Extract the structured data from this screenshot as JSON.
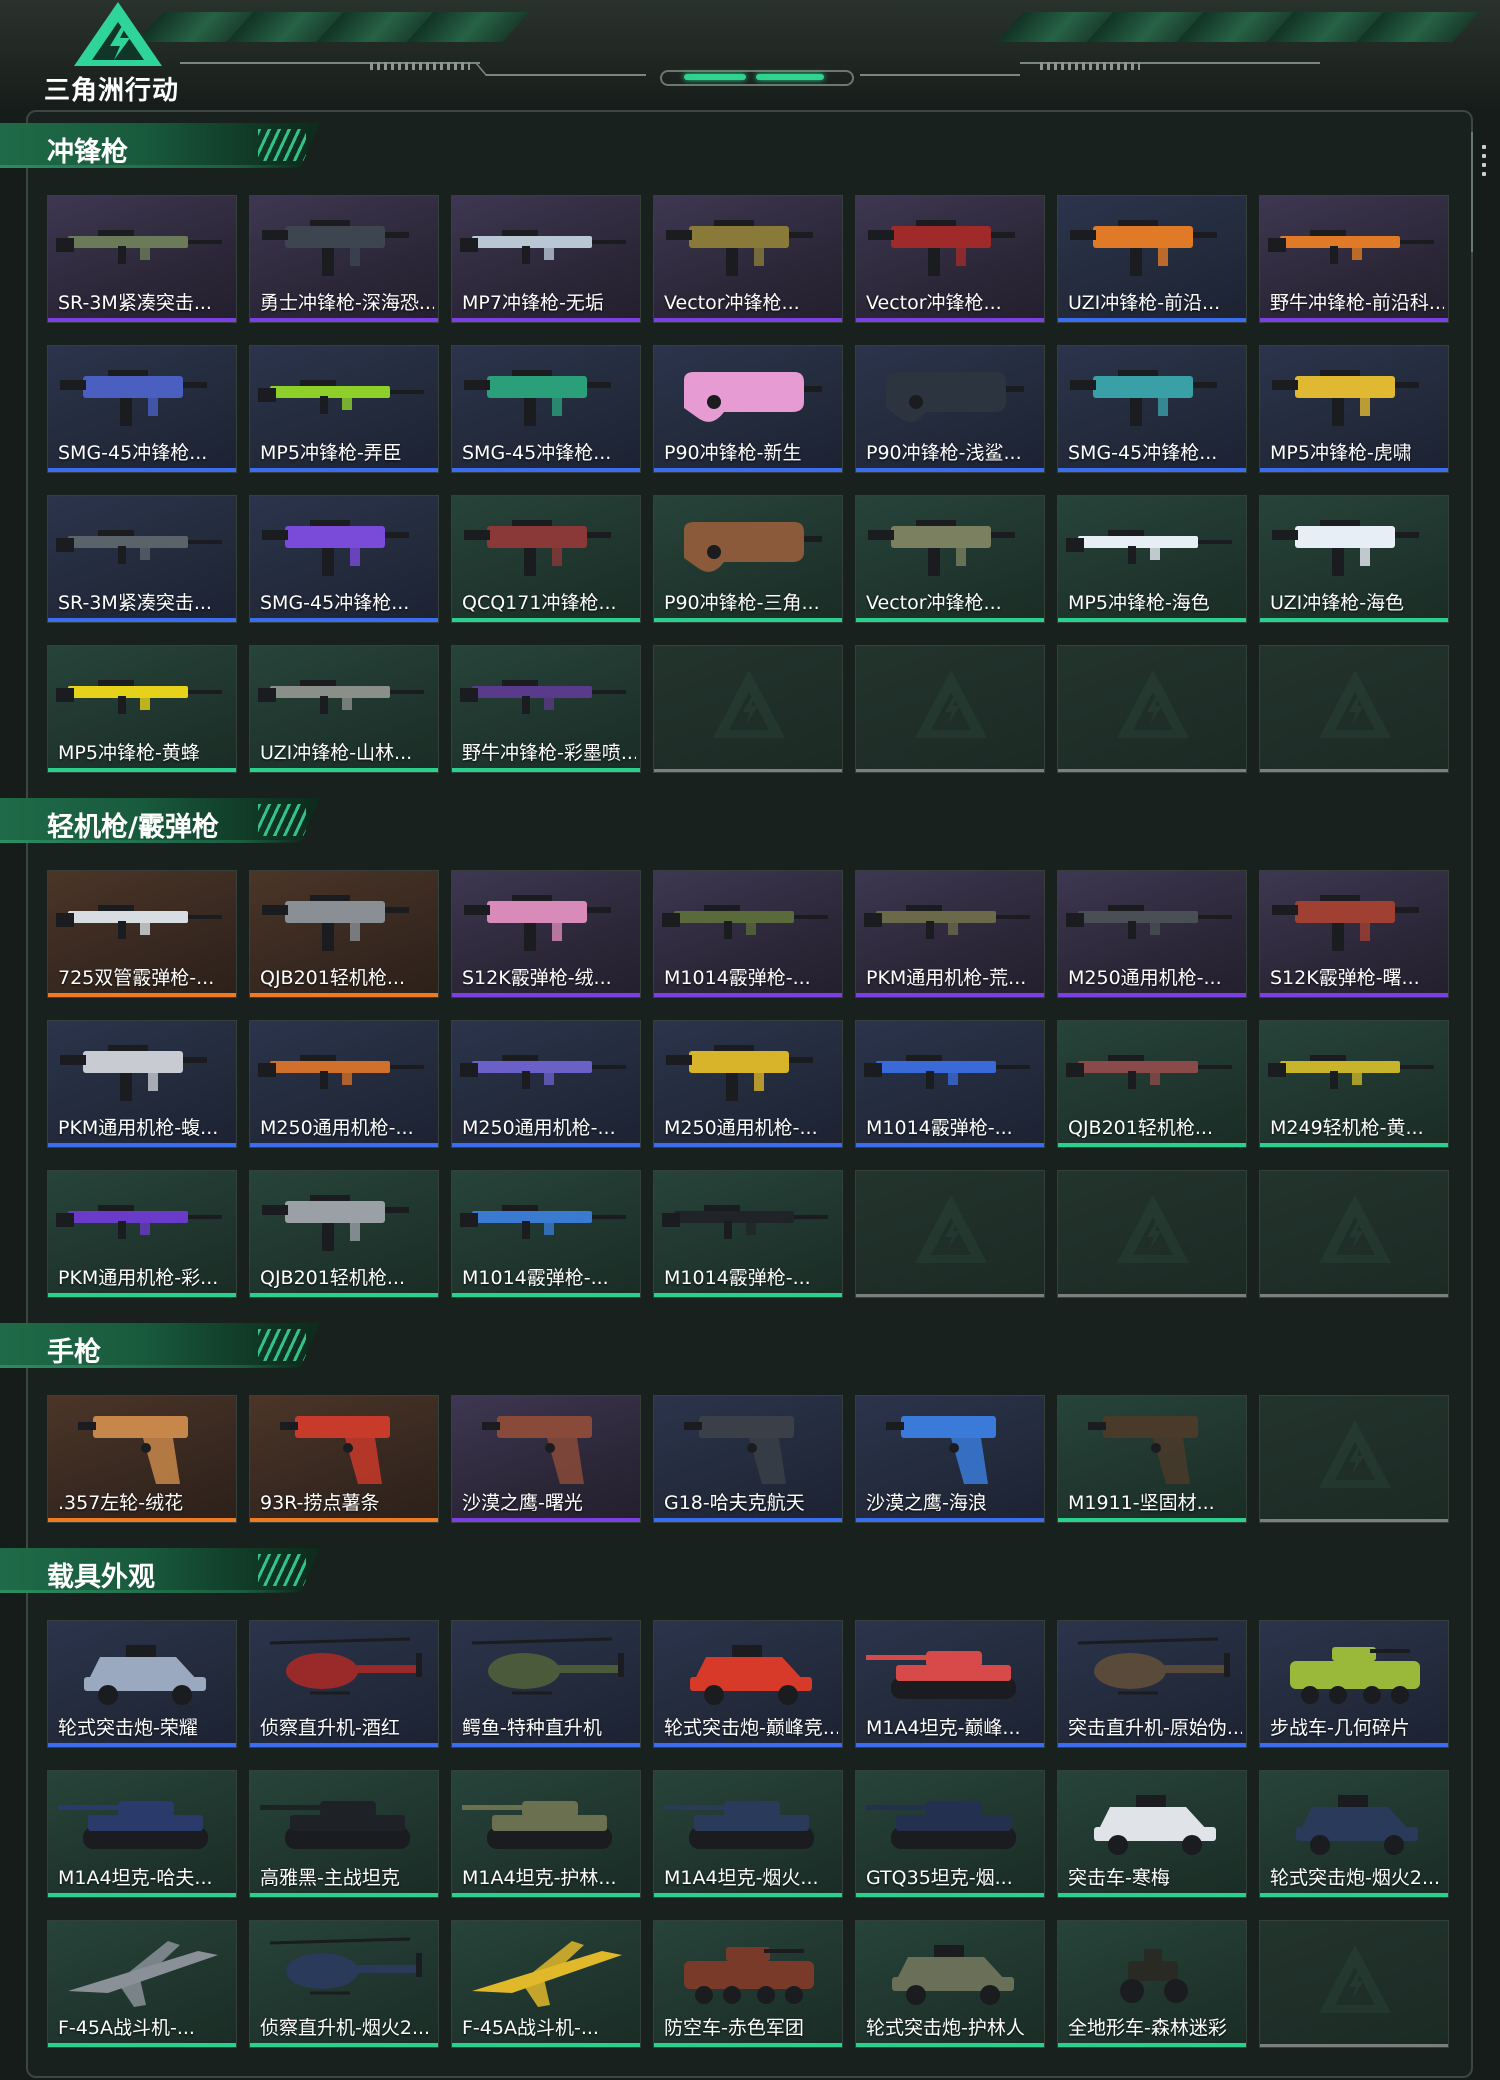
{
  "header": {
    "logo_text": "三角洲行动"
  },
  "colors": {
    "purple": "#7b3fe4",
    "blue": "#3a6df0",
    "green": "#2ad08e",
    "orange": "#f07a21",
    "accent": "#2ed48f"
  },
  "sections": [
    {
      "title": "冲锋枪",
      "items": [
        {
          "label": "SR-3M紧凑突击...",
          "rarity": "purple",
          "kind": "gun",
          "tint": "#6b7a58"
        },
        {
          "label": "勇士冲锋枪-深海恐...",
          "rarity": "purple",
          "kind": "smg",
          "tint": "#3c4550"
        },
        {
          "label": "MP7冲锋枪-无垢",
          "rarity": "purple",
          "kind": "gun",
          "tint": "#b9c6d4"
        },
        {
          "label": "Vector冲锋枪...",
          "rarity": "purple",
          "kind": "smg",
          "tint": "#8a7a3a"
        },
        {
          "label": "Vector冲锋枪...",
          "rarity": "purple",
          "kind": "smg",
          "tint": "#a02a2a"
        },
        {
          "label": "UZI冲锋枪-前沿...",
          "rarity": "blue",
          "kind": "smg",
          "tint": "#e07a26"
        },
        {
          "label": "野牛冲锋枪-前沿科...",
          "rarity": "purple",
          "kind": "gun",
          "tint": "#e07a26"
        },
        {
          "label": "SMG-45冲锋枪...",
          "rarity": "blue",
          "kind": "smg",
          "tint": "#4a5fc0"
        },
        {
          "label": "MP5冲锋枪-弄臣",
          "rarity": "blue",
          "kind": "gun",
          "tint": "#8fcf2a"
        },
        {
          "label": "SMG-45冲锋枪...",
          "rarity": "blue",
          "kind": "smg",
          "tint": "#2a9f7a"
        },
        {
          "label": "P90冲锋枪-新生",
          "rarity": "blue",
          "kind": "p90",
          "tint": "#e79bd3"
        },
        {
          "label": "P90冲锋枪-浅鲨...",
          "rarity": "blue",
          "kind": "p90",
          "tint": "#2c3440"
        },
        {
          "label": "SMG-45冲锋枪...",
          "rarity": "blue",
          "kind": "smg",
          "tint": "#3aa0a8"
        },
        {
          "label": "MP5冲锋枪-虎啸",
          "rarity": "blue",
          "kind": "smg",
          "tint": "#e0b832"
        },
        {
          "label": "SR-3M紧凑突击...",
          "rarity": "blue",
          "kind": "gun",
          "tint": "#5a626a"
        },
        {
          "label": "SMG-45冲锋枪...",
          "rarity": "blue",
          "kind": "smg",
          "tint": "#7a4ad8"
        },
        {
          "label": "QCQ171冲锋枪...",
          "rarity": "green",
          "kind": "smg",
          "tint": "#8a3838"
        },
        {
          "label": "P90冲锋枪-三角...",
          "rarity": "green",
          "kind": "p90",
          "tint": "#8a5a3a"
        },
        {
          "label": "Vector冲锋枪...",
          "rarity": "green",
          "kind": "smg",
          "tint": "#7a8060"
        },
        {
          "label": "MP5冲锋枪-海色",
          "rarity": "green",
          "kind": "gun",
          "tint": "#e8eef6"
        },
        {
          "label": "UZI冲锋枪-海色",
          "rarity": "green",
          "kind": "smg",
          "tint": "#e8eef6"
        },
        {
          "label": "MP5冲锋枪-黄蜂",
          "rarity": "green",
          "kind": "gun",
          "tint": "#e6d21a"
        },
        {
          "label": "UZI冲锋枪-山林...",
          "rarity": "green",
          "kind": "gun",
          "tint": "#8a8f8a"
        },
        {
          "label": "野牛冲锋枪-彩墨喷...",
          "rarity": "green",
          "kind": "gun",
          "tint": "#5a3a8a"
        },
        {
          "empty": true
        },
        {
          "empty": true
        },
        {
          "empty": true
        },
        {
          "empty": true
        }
      ]
    },
    {
      "title": "轻机枪/霰弹枪",
      "items": [
        {
          "label": "725双管霰弹枪-...",
          "rarity": "orange",
          "kind": "gun",
          "tint": "#d8dde2"
        },
        {
          "label": "QJB201轻机枪...",
          "rarity": "orange",
          "kind": "smg",
          "tint": "#8a8f95"
        },
        {
          "label": "S12K霰弹枪-绒...",
          "rarity": "purple",
          "kind": "smg",
          "tint": "#d88ab8"
        },
        {
          "label": "M1014霰弹枪-...",
          "rarity": "purple",
          "kind": "gun",
          "tint": "#5a6a3a"
        },
        {
          "label": "PKM通用机枪-荒...",
          "rarity": "purple",
          "kind": "gun",
          "tint": "#6a6a4a"
        },
        {
          "label": "M250通用机枪-...",
          "rarity": "purple",
          "kind": "gun",
          "tint": "#4a4f55"
        },
        {
          "label": "S12K霰弹枪-曙...",
          "rarity": "purple",
          "kind": "smg",
          "tint": "#a04032"
        },
        {
          "label": "PKM通用机枪-蝮...",
          "rarity": "blue",
          "kind": "smg",
          "tint": "#c8ccd2"
        },
        {
          "label": "M250通用机枪-...",
          "rarity": "blue",
          "kind": "gun",
          "tint": "#d0702a"
        },
        {
          "label": "M250通用机枪-...",
          "rarity": "blue",
          "kind": "gun",
          "tint": "#6a60c8"
        },
        {
          "label": "M250通用机枪-...",
          "rarity": "blue",
          "kind": "smg",
          "tint": "#d8b42a"
        },
        {
          "label": "M1014霰弹枪-...",
          "rarity": "blue",
          "kind": "gun",
          "tint": "#3a6ad8"
        },
        {
          "label": "QJB201轻机枪...",
          "rarity": "green",
          "kind": "gun",
          "tint": "#8a4a4a"
        },
        {
          "label": "M249轻机枪-黄...",
          "rarity": "green",
          "kind": "gun",
          "tint": "#c8b42a"
        },
        {
          "label": "PKM通用机枪-彩...",
          "rarity": "green",
          "kind": "gun",
          "tint": "#6a3ac8"
        },
        {
          "label": "QJB201轻机枪...",
          "rarity": "green",
          "kind": "smg",
          "tint": "#9aa0a6"
        },
        {
          "label": "M1014霰弹枪-...",
          "rarity": "green",
          "kind": "gun",
          "tint": "#3a7ad0"
        },
        {
          "label": "M1014霰弹枪-...",
          "rarity": "green",
          "kind": "gun",
          "tint": "#202428"
        },
        {
          "empty": true
        },
        {
          "empty": true
        },
        {
          "empty": true
        }
      ]
    },
    {
      "title": "手枪",
      "items": [
        {
          "label": ".357左轮-绒花",
          "rarity": "orange",
          "kind": "pistol",
          "tint": "#c8874a"
        },
        {
          "label": "93R-捞点薯条",
          "rarity": "orange",
          "kind": "pistol",
          "tint": "#c83a2a"
        },
        {
          "label": "沙漠之鹰-曙光",
          "rarity": "purple",
          "kind": "pistol",
          "tint": "#8a4a3a"
        },
        {
          "label": "G18-哈夫克航天",
          "rarity": "blue",
          "kind": "pistol",
          "tint": "#3a3f48"
        },
        {
          "label": "沙漠之鹰-海浪",
          "rarity": "blue",
          "kind": "pistol",
          "tint": "#3a7ad8"
        },
        {
          "label": "M1911-坚固材...",
          "rarity": "green",
          "kind": "pistol",
          "tint": "#4a3a2a"
        },
        {
          "empty": true
        }
      ]
    },
    {
      "title": "载具外观",
      "items": [
        {
          "label": "轮式突击炮-荣耀",
          "rarity": "blue",
          "kind": "car",
          "tint": "#9aa8c0"
        },
        {
          "label": "侦察直升机-酒红",
          "rarity": "blue",
          "kind": "heli",
          "tint": "#9a2a2a"
        },
        {
          "label": "鳄鱼-特种直升机",
          "rarity": "blue",
          "kind": "heli",
          "tint": "#4a5a3a"
        },
        {
          "label": "轮式突击炮-巅峰竞...",
          "rarity": "blue",
          "kind": "car",
          "tint": "#d83a2a"
        },
        {
          "label": "M1A4坦克-巅峰...",
          "rarity": "blue",
          "kind": "tank",
          "tint": "#d84a4a"
        },
        {
          "label": "突击直升机-原始伪...",
          "rarity": "blue",
          "kind": "heli",
          "tint": "#5a4a3a"
        },
        {
          "label": "步战车-几何碎片",
          "rarity": "blue",
          "kind": "apc",
          "tint": "#9ab83a"
        },
        {
          "label": "M1A4坦克-哈夫...",
          "rarity": "green",
          "kind": "tank",
          "tint": "#2a3a6a"
        },
        {
          "label": "高雅黑-主战坦克",
          "rarity": "green",
          "kind": "tank",
          "tint": "#1e2226"
        },
        {
          "label": "M1A4坦克-护林...",
          "rarity": "green",
          "kind": "tank",
          "tint": "#6a7050"
        },
        {
          "label": "M1A4坦克-烟火...",
          "rarity": "green",
          "kind": "tank",
          "tint": "#2a3a5a"
        },
        {
          "label": "GTQ35坦克-烟...",
          "rarity": "green",
          "kind": "tank",
          "tint": "#243050"
        },
        {
          "label": "突击车-寒梅",
          "rarity": "green",
          "kind": "car",
          "tint": "#e0e4e8"
        },
        {
          "label": "轮式突击炮-烟火2...",
          "rarity": "green",
          "kind": "car",
          "tint": "#2a3a5a"
        },
        {
          "label": "F-45A战斗机-...",
          "rarity": "green",
          "kind": "jet",
          "tint": "#8a9098"
        },
        {
          "label": "侦察直升机-烟火2...",
          "rarity": "green",
          "kind": "heli",
          "tint": "#2a3a5a"
        },
        {
          "label": "F-45A战斗机-...",
          "rarity": "green",
          "kind": "jet",
          "tint": "#e0b82a"
        },
        {
          "label": "防空车-赤色军团",
          "rarity": "green",
          "kind": "apc",
          "tint": "#7a3a2a"
        },
        {
          "label": "轮式突击炮-护林人",
          "rarity": "green",
          "kind": "car",
          "tint": "#6a7058"
        },
        {
          "label": "全地形车-森林迷彩",
          "rarity": "green",
          "kind": "atv",
          "tint": "#2a2a24"
        },
        {
          "empty": true
        }
      ]
    }
  ]
}
